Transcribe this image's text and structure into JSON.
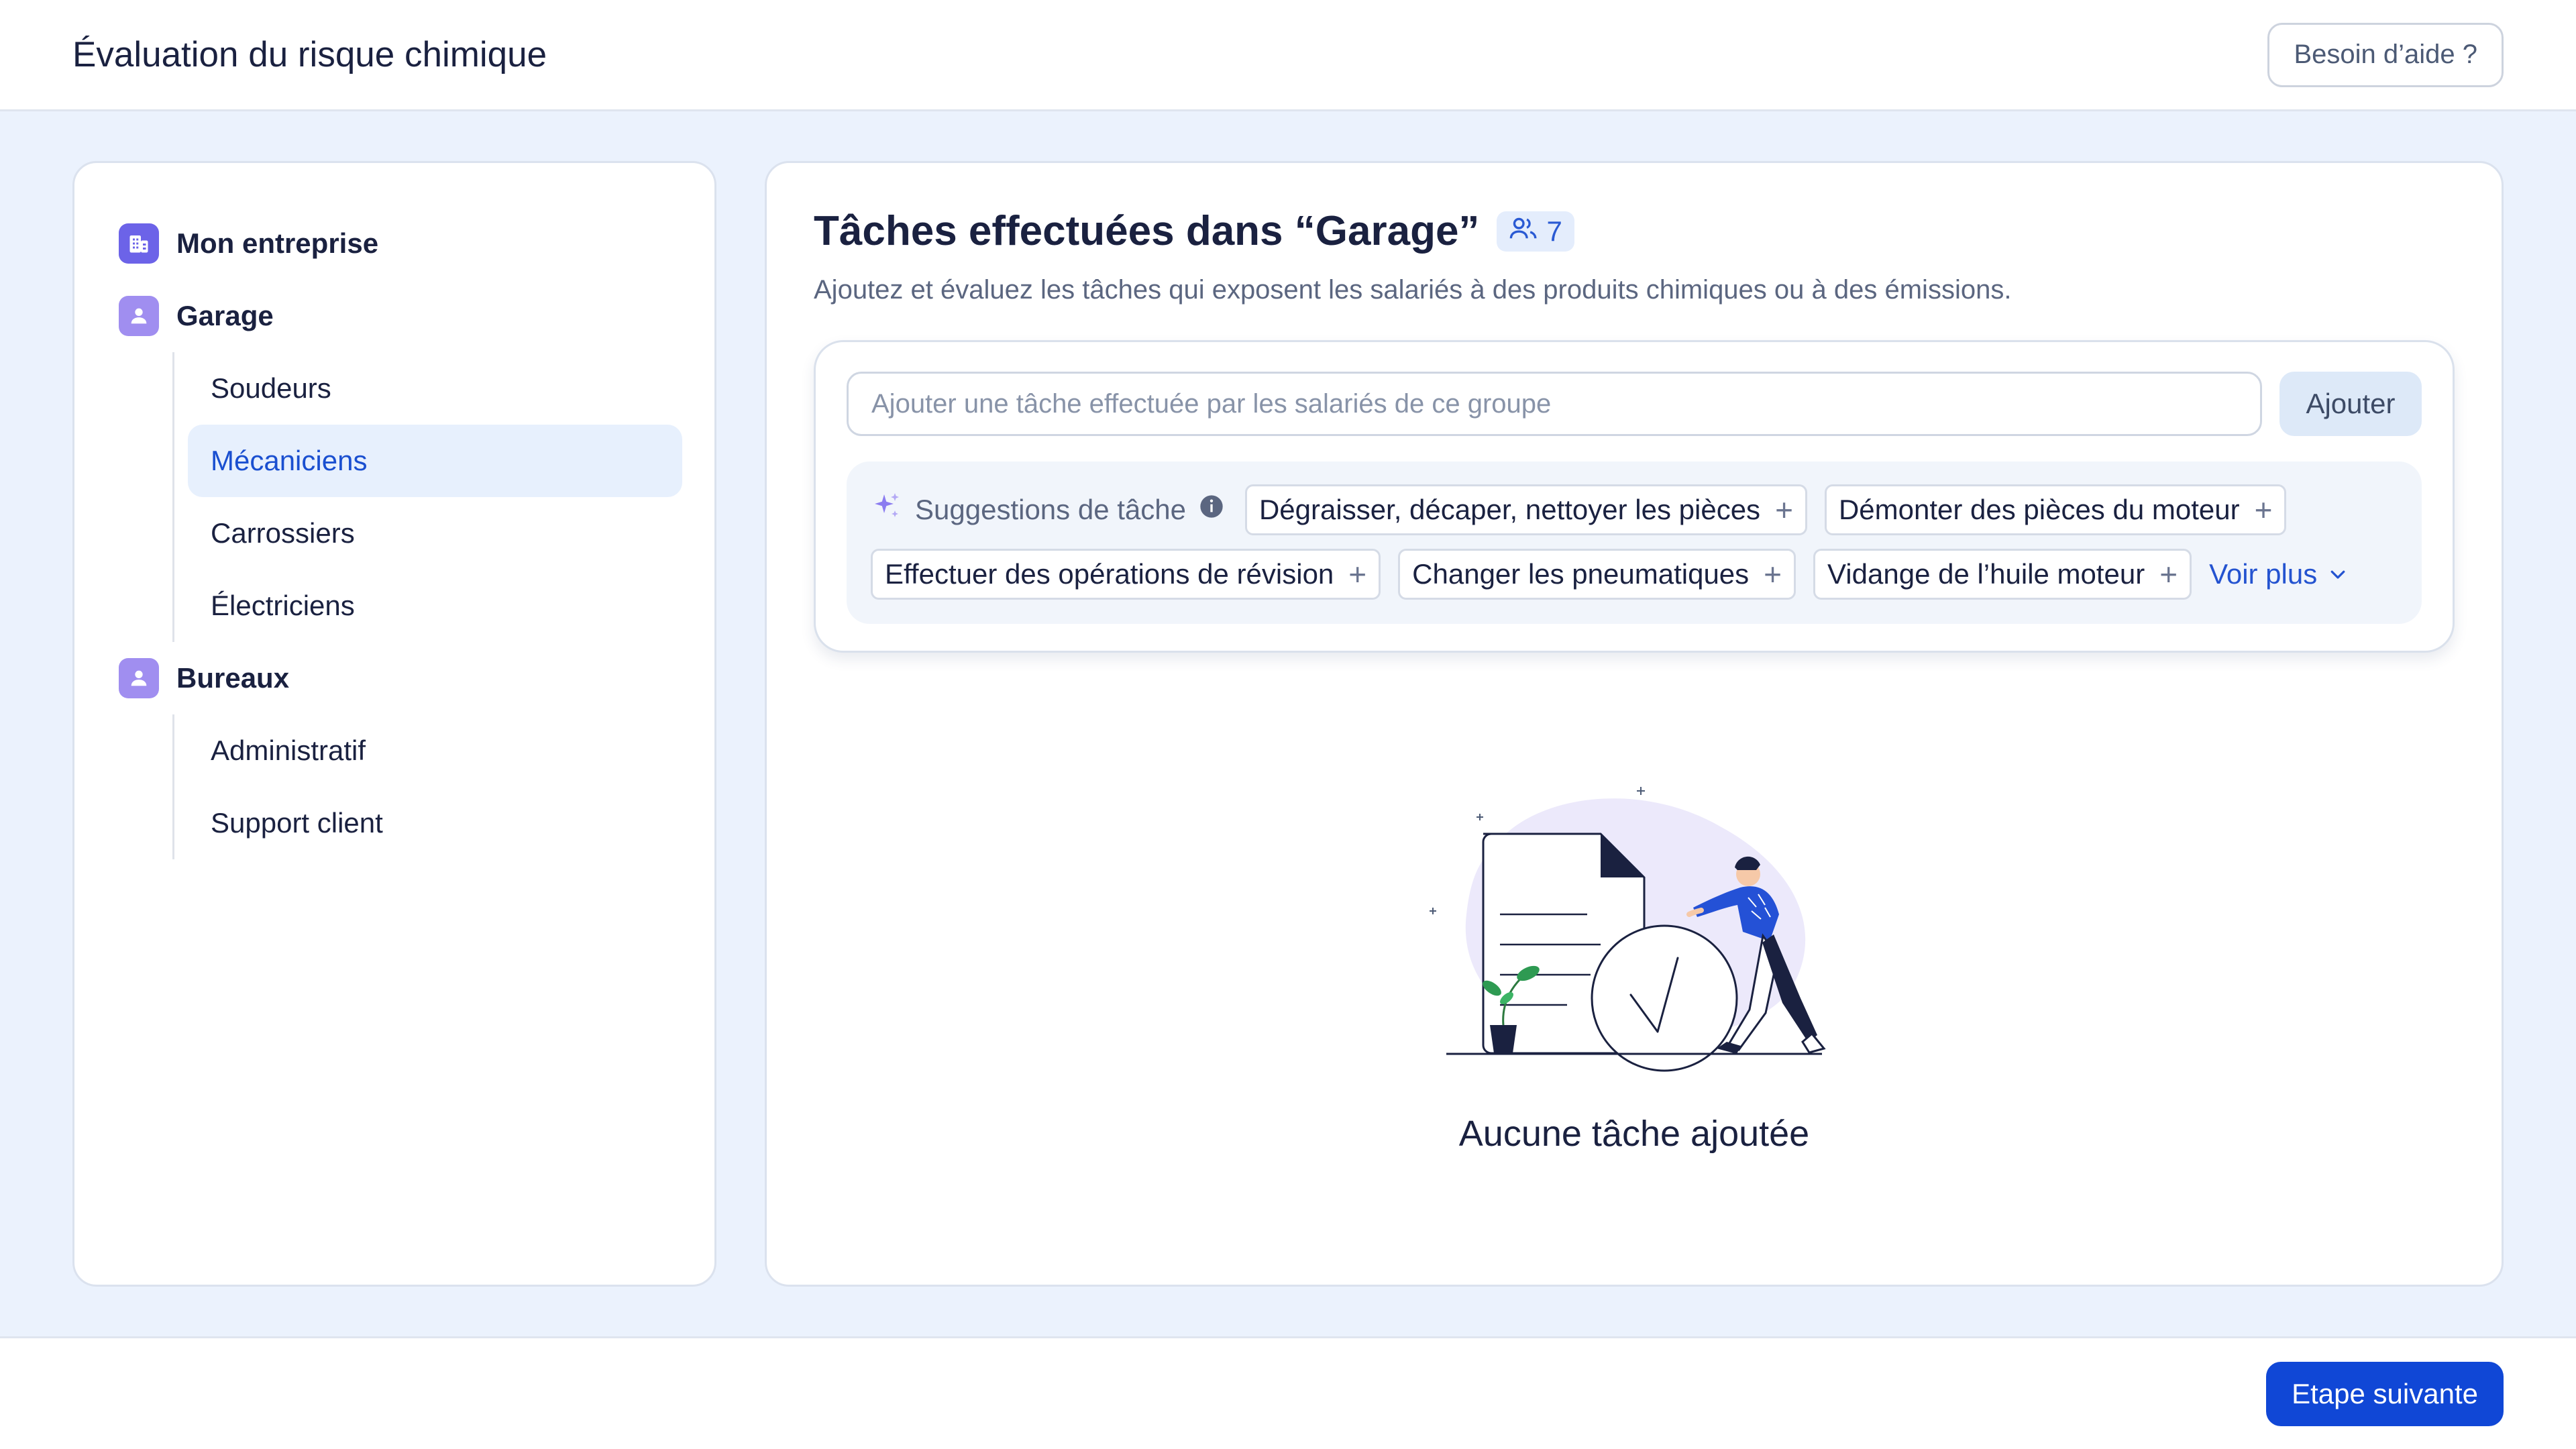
{
  "header": {
    "title": "Évaluation du risque chimique",
    "help_label": "Besoin d’aide ?"
  },
  "sidebar": {
    "company": {
      "label": "Mon entreprise",
      "icon": "building-icon"
    },
    "groups": [
      {
        "label": "Garage",
        "icon": "user-icon",
        "children": [
          "Soudeurs",
          "Mécaniciens",
          "Carrossiers",
          "Électriciens"
        ]
      },
      {
        "label": "Bureaux",
        "icon": "user-icon",
        "children": [
          "Administratif",
          "Support client"
        ]
      }
    ],
    "active_item": "Mécaniciens"
  },
  "main": {
    "title": "Tâches effectuées dans “Garage”",
    "employee_count": "7",
    "subtitle": "Ajoutez et évaluez les tâches qui exposent les salariés à des produits chimiques ou à des émissions.",
    "task_input": {
      "placeholder": "Ajouter une tâche effectuée par les salariés de ce groupe",
      "value": ""
    },
    "add_label": "Ajouter",
    "suggestions": {
      "label": "Suggestions de tâche",
      "chips": [
        "Dégraisser, décaper, nettoyer les pièces",
        "Démonter des pièces du moteur",
        "Effectuer des opérations de révision",
        "Changer les pneumatiques",
        "Vidange de l’huile moteur"
      ],
      "more_label": "Voir plus"
    },
    "empty_text": "Aucune tâche ajoutée"
  },
  "footer": {
    "next_label": "Etape suivante"
  },
  "colors": {
    "accent": "#1047d6",
    "active_bg": "#e7f0fd",
    "badge_purple": "#a08ef0",
    "page_bg": "#ebf2fd"
  }
}
